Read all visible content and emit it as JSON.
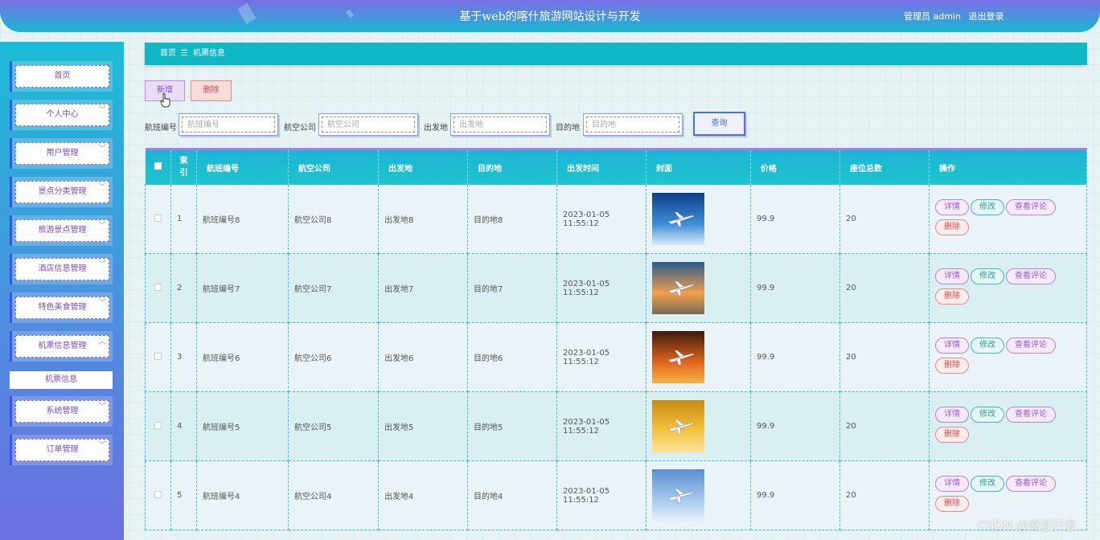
{
  "header": {
    "site_title": "基于web的喀什旅游网站设计与开发",
    "user_label": "管理员 admin",
    "logout_label": "退出登录"
  },
  "sidebar": {
    "items": [
      {
        "label": "首页",
        "chevron": ""
      },
      {
        "label": "个人中心",
        "chevron": "﹀"
      },
      {
        "label": "用户管理",
        "chevron": "﹀"
      },
      {
        "label": "景点分类管理",
        "chevron": "﹀"
      },
      {
        "label": "旅游景点管理",
        "chevron": "﹀"
      },
      {
        "label": "酒店信息管理",
        "chevron": "﹀"
      },
      {
        "label": "特色美食管理",
        "chevron": "﹀"
      },
      {
        "label": "机票信息管理",
        "chevron": "︿"
      },
      {
        "label": "系统管理",
        "chevron": "﹀"
      },
      {
        "label": "订单管理",
        "chevron": "﹀"
      }
    ],
    "submenu_label": "机票信息"
  },
  "breadcrumb": {
    "home": "首页",
    "separator": "☰",
    "current": "机票信息"
  },
  "actions": {
    "add_label": "新增",
    "delete_label": "删除"
  },
  "search": {
    "flight_no_label": "航班编号",
    "flight_no_placeholder": "航班编号",
    "airline_label": "航空公司",
    "airline_placeholder": "航空公司",
    "origin_label": "出发地",
    "origin_placeholder": "出发地",
    "destination_label": "目的地",
    "destination_placeholder": "目的地",
    "query_label": "查询"
  },
  "table": {
    "columns": [
      "索引",
      "航班编号",
      "航空公司",
      "出发地",
      "目的地",
      "出发时间",
      "封面",
      "价格",
      "座位总数",
      "操作"
    ],
    "op_labels": {
      "detail": "详情",
      "edit": "修改",
      "review": "查看评论",
      "delete": "删除"
    },
    "rows": [
      {
        "index": "1",
        "flight_no": "航班编号8",
        "airline": "航空公司8",
        "origin": "出发地8",
        "destination": "目的地8",
        "departure": "2023-01-05 11:55:12",
        "price": "99.9",
        "seats": "20"
      },
      {
        "index": "2",
        "flight_no": "航班编号7",
        "airline": "航空公司7",
        "origin": "出发地7",
        "destination": "目的地7",
        "departure": "2023-01-05 11:55:12",
        "price": "99.9",
        "seats": "20"
      },
      {
        "index": "3",
        "flight_no": "航班编号6",
        "airline": "航空公司6",
        "origin": "出发地6",
        "destination": "目的地6",
        "departure": "2023-01-05 11:55:12",
        "price": "99.9",
        "seats": "20"
      },
      {
        "index": "4",
        "flight_no": "航班编号5",
        "airline": "航空公司5",
        "origin": "出发地5",
        "destination": "目的地5",
        "departure": "2023-01-05 11:55:12",
        "price": "99.9",
        "seats": "20"
      },
      {
        "index": "5",
        "flight_no": "航班编号4",
        "airline": "航空公司4",
        "origin": "出发地4",
        "destination": "目的地4",
        "departure": "2023-01-05 11:55:12",
        "price": "99.9",
        "seats": "20"
      }
    ]
  },
  "watermark": "CSDN @疯狂行者",
  "colors": {
    "header_start": "#7b6fe6",
    "header_end": "#17b8d2",
    "breadcrumb_bg": "#10b7c4",
    "accent_purple": "#7b4dc4",
    "danger": "#d94b4b",
    "table_head": "#1db3d5"
  }
}
